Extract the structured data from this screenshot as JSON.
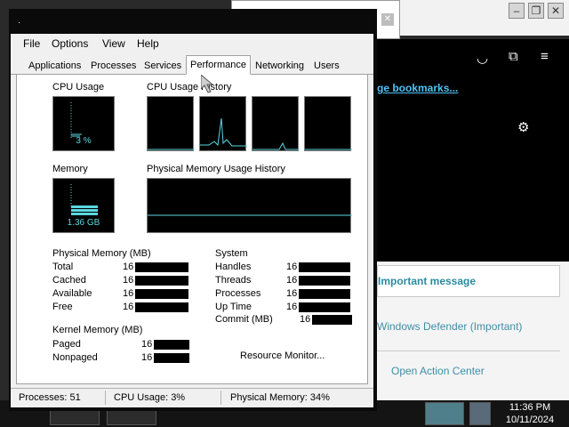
{
  "browser": {
    "bookmarks_link": "ge bookmarks...",
    "notice": "Important message",
    "defender": "Windows Defender (Important)",
    "action_center": "Open Action Center"
  },
  "taskbar": {
    "time": "11:36 PM",
    "date": "10/11/2024"
  },
  "menu": [
    "File",
    "Options",
    "View",
    "Help"
  ],
  "tabs": [
    "Applications",
    "Processes",
    "Services",
    "Performance",
    "Networking",
    "Users"
  ],
  "active_tab": "Performance",
  "perf": {
    "cpu_usage_label": "CPU Usage",
    "cpu_history_label": "CPU Usage History",
    "cpu_usage_value": "3 %",
    "memory_label": "Memory",
    "memory_value": "1.36 GB",
    "phys_history_label": "Physical Memory Usage History"
  },
  "physical_memory": {
    "title": "Physical Memory (MB)",
    "rows": [
      "Total",
      "Cached",
      "Available",
      "Free"
    ],
    "value_prefix": "16"
  },
  "kernel_memory": {
    "title": "Kernel Memory (MB)",
    "rows": [
      "Paged",
      "Nonpaged"
    ],
    "value_prefix": "16"
  },
  "system": {
    "title": "System",
    "rows": [
      "Handles",
      "Threads",
      "Processes",
      "Up Time",
      "Commit (MB)"
    ],
    "value_prefix": "16"
  },
  "resource_monitor": "Resource Monitor...",
  "status": {
    "processes": "Processes: 51",
    "cpu": "CPU Usage: 3%",
    "memory": "Physical Memory: 34%"
  },
  "cpu_usage_percent": 3,
  "memory_usage_percent": 34
}
